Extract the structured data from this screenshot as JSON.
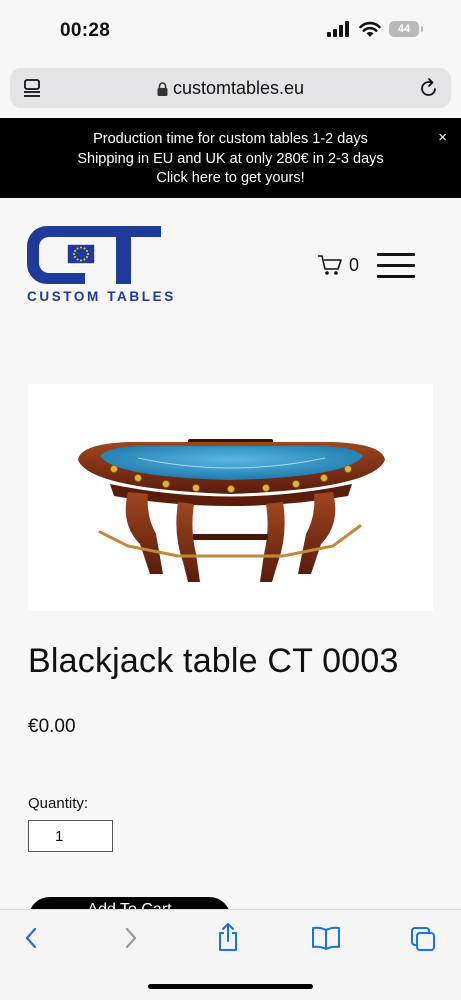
{
  "status_bar": {
    "time": "00:28",
    "battery": "44"
  },
  "browser": {
    "url": "customtables.eu"
  },
  "banner": {
    "lines": [
      "Production time for custom tables 1-2 days",
      "Shipping in EU and UK at only 280€ in 2-3 days",
      "Click here to get yours!"
    ],
    "close": "×"
  },
  "header": {
    "logo_text": "CUSTOM TABLES",
    "cart_count": "0"
  },
  "product": {
    "title": "Blackjack table CT 0003",
    "price": "€0.00",
    "quantity_label": "Quantity:",
    "quantity_value": "1",
    "add_to_cart": "Add To Cart"
  },
  "colors": {
    "brand_blue": "#1f3a9a",
    "banner_bg": "#000000",
    "felt": "#2a8fc4",
    "wood": "#7a2a14",
    "ios_blue": "#1a73e8"
  },
  "icons": [
    "signal-icon",
    "wifi-icon",
    "battery-icon",
    "tabs-icon",
    "lock-icon",
    "reload-icon",
    "close-icon",
    "cart-icon",
    "menu-icon",
    "back-icon",
    "forward-icon",
    "share-icon",
    "bookmarks-icon",
    "tabs-overview-icon"
  ]
}
